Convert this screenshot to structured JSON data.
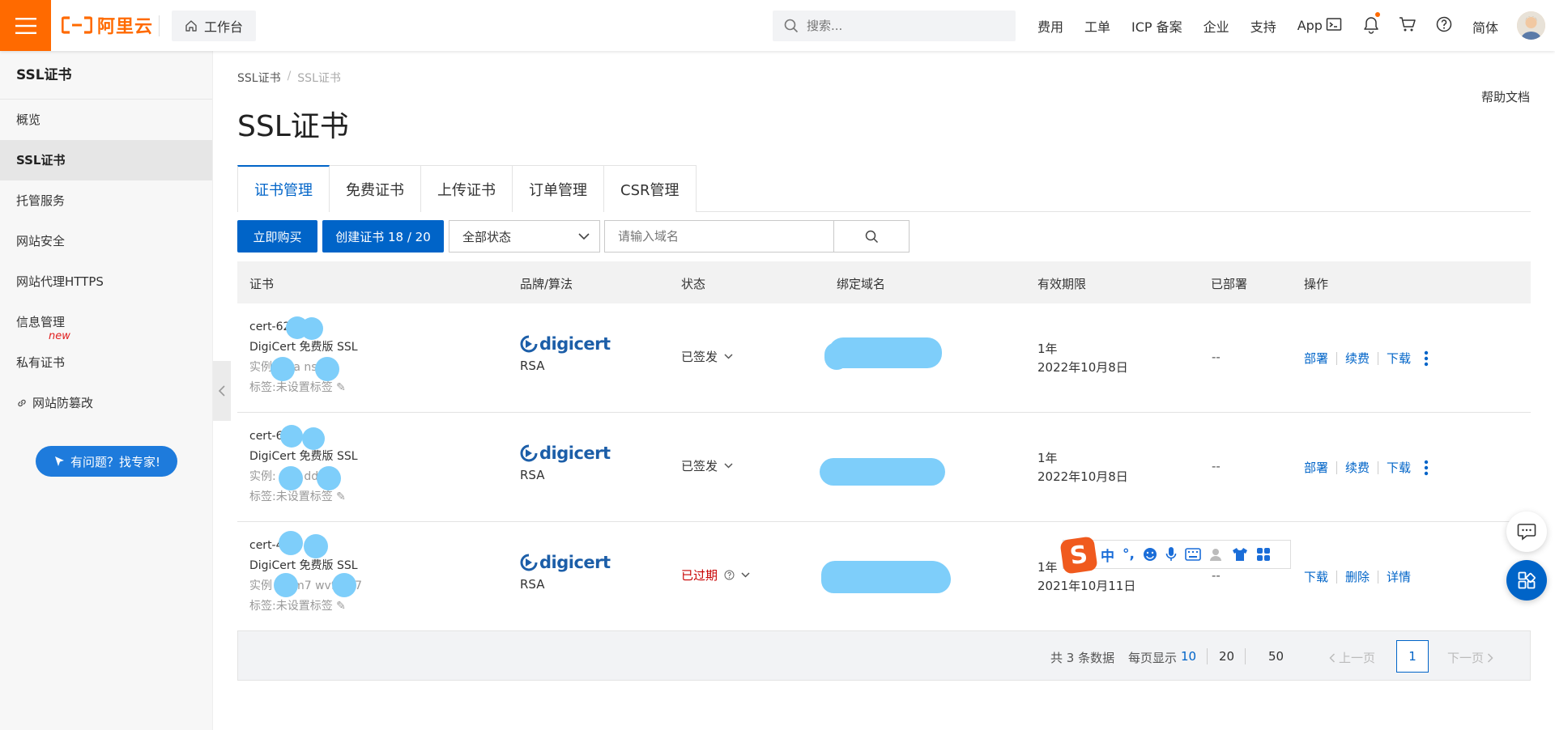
{
  "topbar": {
    "logo_text": "阿里云",
    "workbench_label": "工作台",
    "search_placeholder": "搜索...",
    "links": [
      "费用",
      "工单",
      "ICP 备案",
      "企业",
      "支持",
      "App"
    ],
    "lang": "简体",
    "brand_color": "#ff6a00"
  },
  "sidebar": {
    "title": "SSL证书",
    "items": [
      {
        "label": "概览"
      },
      {
        "label": "SSL证书",
        "active": true
      },
      {
        "label": "托管服务"
      },
      {
        "label": "网站安全"
      },
      {
        "label": "网站代理HTTPS"
      },
      {
        "label": "信息管理"
      },
      {
        "label": "私有证书",
        "badge": "new"
      },
      {
        "label": "网站防篡改"
      }
    ],
    "expert_button": "有问题？找专家!"
  },
  "breadcrumb": [
    "SSL证书",
    "SSL证书"
  ],
  "help_doc": "帮助文档",
  "page_title": "SSL证书",
  "tabs": [
    "证书管理",
    "免费证书",
    "上传证书",
    "订单管理",
    "CSR管理"
  ],
  "toolbar": {
    "buy_now": "立即购买",
    "create_cert": "创建证书 18 / 20",
    "status_select": "全部状态",
    "domain_placeholder": "请输入域名"
  },
  "table": {
    "headers": [
      "证书",
      "品牌/算法",
      "状态",
      "绑定域名",
      "有效期限",
      "已部署",
      "操作"
    ],
    "rows": [
      {
        "cert_name": "cert-62",
        "product": "DigiCert 免费版 SSL",
        "instance": "实例:     -iva     ns8llz",
        "tag": "标签:未设置标签",
        "brand": "digicert",
        "algo": "RSA",
        "status": "已签发",
        "validity_term": "1年",
        "validity_date": "2022年10月8日",
        "deployed": "--",
        "ops": [
          "部署",
          "续费",
          "下载"
        ]
      },
      {
        "cert_name": "cert-62",
        "product": "DigiCert 免费版 SSL",
        "instance": "实例:     vau     dd1Tp",
        "tag": "标签:未设置标签",
        "brand": "digicert",
        "algo": "RSA",
        "status": "已签发",
        "validity_term": "1年",
        "validity_date": "2022年10月8日",
        "deployed": "--",
        "ops": [
          "部署",
          "续费",
          "下载"
        ]
      },
      {
        "cert_name": "cert-4",
        "product": "DigiCert 免费版 SSL",
        "instance": "实例     cn-m7     wv91w7",
        "tag": "标签:未设置标签",
        "brand": "digicert",
        "algo": "RSA",
        "status": "已过期",
        "validity_term": "1年",
        "validity_date": "2021年10月11日",
        "deployed": "--",
        "ops": [
          "下载",
          "删除",
          "详情"
        ]
      }
    ]
  },
  "pagination": {
    "total": "共 3 条数据",
    "per_page_label": "每页显示",
    "sizes": [
      "10",
      "20",
      "50"
    ],
    "prev": "上一页",
    "page": "1",
    "next": "下一页"
  },
  "ime": {
    "mode": "中",
    "punct": "°,"
  },
  "colors": {
    "primary": "#0064c8",
    "expired": "#c80000",
    "redaction": "#7ecefa"
  }
}
